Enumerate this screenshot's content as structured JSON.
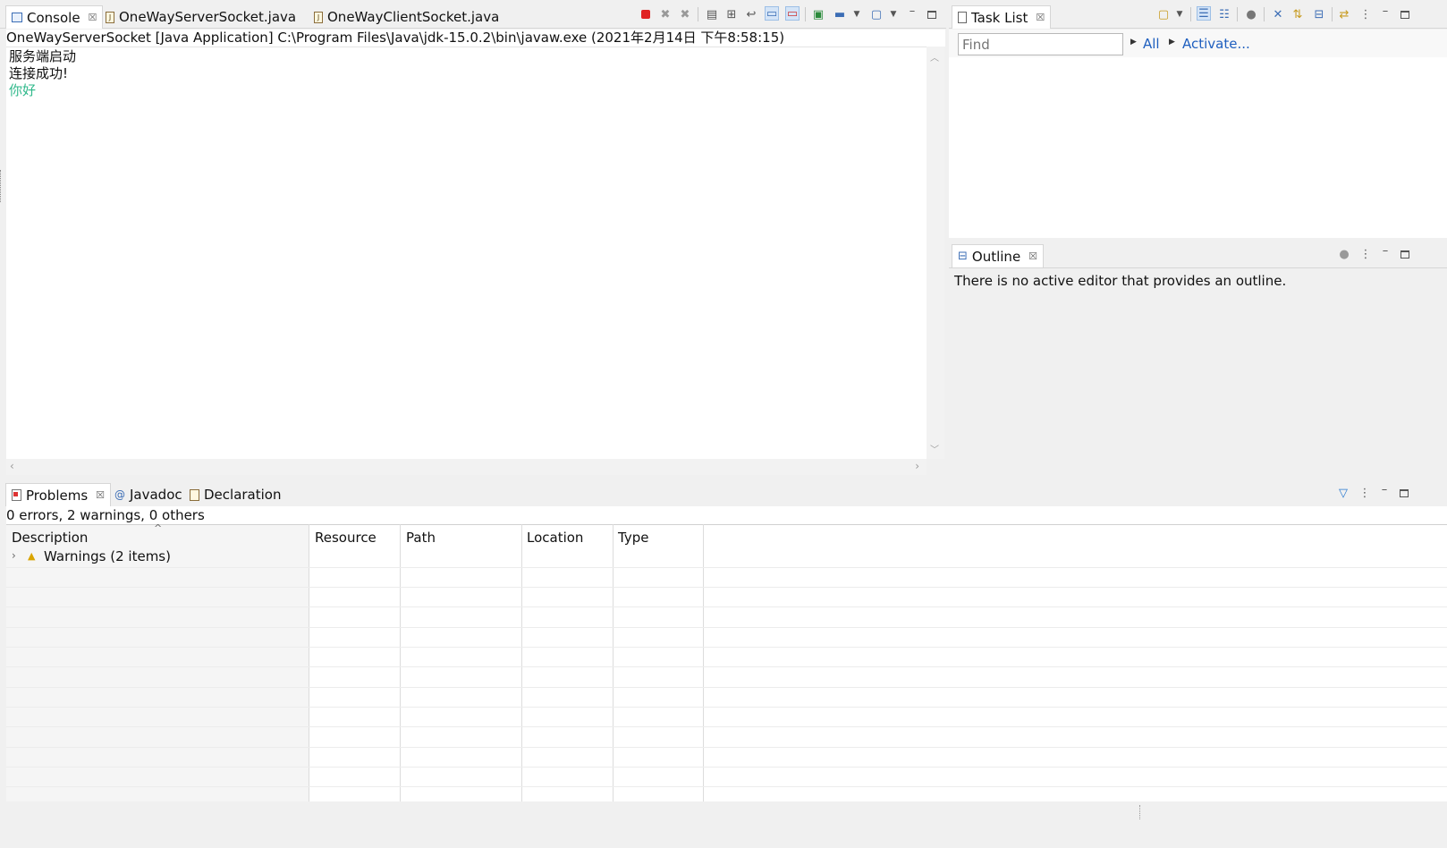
{
  "console_panel": {
    "tabs": [
      {
        "label": "Console",
        "icon": "console-icon"
      },
      {
        "label": "OneWayServerSocket.java",
        "icon": "java-file-icon"
      },
      {
        "label": "OneWayClientSocket.java",
        "icon": "java-file-icon"
      }
    ],
    "launch_info": "OneWayServerSocket [Java Application] C:\\Program Files\\Java\\jdk-15.0.2\\bin\\javaw.exe  (2021年2月14日 下午8:58:15)",
    "output_lines": [
      "服务端启动",
      "连接成功!"
    ],
    "input_line": "你好",
    "input_color": "#2eb88a",
    "stop_color": "#e02424"
  },
  "task_list": {
    "tab_label": "Task List",
    "find_placeholder": "Find",
    "filter_all": "All",
    "filter_activate": "Activate..."
  },
  "outline": {
    "tab_label": "Outline",
    "message": "There is no active editor that provides an outline."
  },
  "problems": {
    "tabs": [
      {
        "label": "Problems",
        "icon": "problems-icon"
      },
      {
        "label": "Javadoc",
        "icon": "javadoc-icon"
      },
      {
        "label": "Declaration",
        "icon": "declaration-icon"
      }
    ],
    "summary": "0 errors, 2 warnings, 0 others",
    "columns": [
      "Description",
      "Resource",
      "Path",
      "Location",
      "Type"
    ],
    "rows": [
      {
        "description": "Warnings (2 items)",
        "icon": "warning-icon"
      }
    ]
  },
  "colors": {
    "link": "#1f5fbf",
    "pressed_bg": "#d4e4f7"
  }
}
